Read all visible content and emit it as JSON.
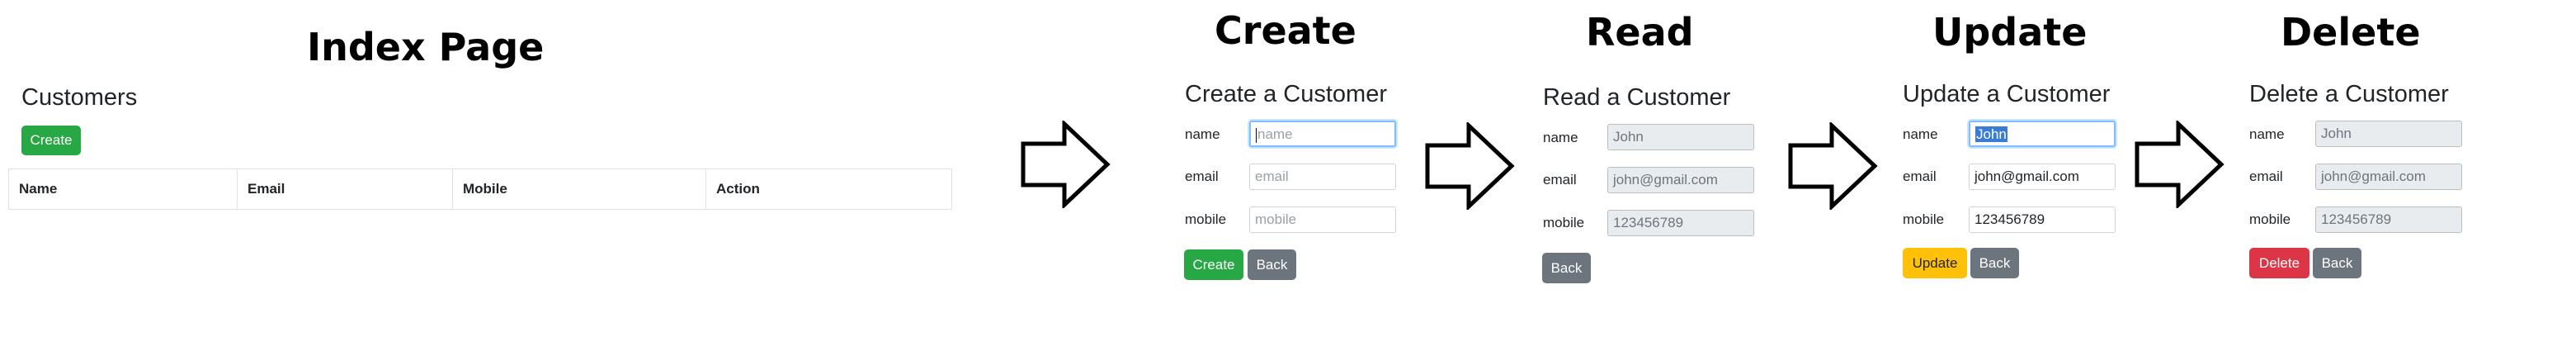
{
  "index": {
    "heading": "Index Page",
    "title": "Customers",
    "create_button": "Create",
    "table_headers": [
      "Name",
      "Email",
      "Mobile",
      "Action"
    ]
  },
  "create": {
    "heading": "Create",
    "title": "Create a Customer",
    "fields": {
      "name": {
        "label": "name",
        "placeholder": "name"
      },
      "email": {
        "label": "email",
        "placeholder": "email"
      },
      "mobile": {
        "label": "mobile",
        "placeholder": "mobile"
      }
    },
    "primary_button": "Create",
    "back_button": "Back"
  },
  "read": {
    "heading": "Read",
    "title": "Read a Customer",
    "fields": {
      "name": {
        "label": "name",
        "value": "John"
      },
      "email": {
        "label": "email",
        "value": "john@gmail.com"
      },
      "mobile": {
        "label": "mobile",
        "value": "123456789"
      }
    },
    "back_button": "Back"
  },
  "update": {
    "heading": "Update",
    "title": "Update a Customer",
    "fields": {
      "name": {
        "label": "name",
        "value": "John"
      },
      "email": {
        "label": "email",
        "value": "john@gmail.com"
      },
      "mobile": {
        "label": "mobile",
        "value": "123456789"
      }
    },
    "primary_button": "Update",
    "back_button": "Back"
  },
  "delete": {
    "heading": "Delete",
    "title": "Delete a Customer",
    "fields": {
      "name": {
        "label": "name",
        "value": "John"
      },
      "email": {
        "label": "email",
        "value": "john@gmail.com"
      },
      "mobile": {
        "label": "mobile",
        "value": "123456789"
      }
    },
    "primary_button": "Delete",
    "back_button": "Back"
  },
  "icons": [
    "right-arrow-icon"
  ],
  "colors": {
    "create": "#28a745",
    "back": "#6c757d",
    "update": "#ffc107",
    "delete": "#dc3545",
    "focus": "#80bdff"
  }
}
